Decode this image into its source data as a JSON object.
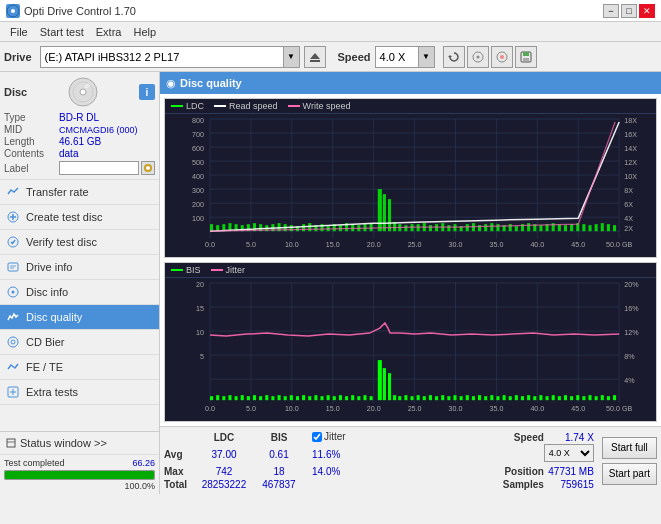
{
  "app": {
    "title": "Opti Drive Control 1.70",
    "icon": "disc-icon"
  },
  "titlebar": {
    "title": "Opti Drive Control 1.70",
    "minimize": "−",
    "maximize": "□",
    "close": "✕"
  },
  "menubar": {
    "items": [
      "File",
      "Start test",
      "Extra",
      "Help"
    ]
  },
  "drive_bar": {
    "label": "Drive",
    "drive_value": "(E:)  ATAPI iHBS312  2 PL17",
    "speed_label": "Speed",
    "speed_value": "4.0 X"
  },
  "disc_info": {
    "type_label": "Type",
    "type_value": "BD-R DL",
    "mid_label": "MID",
    "mid_value": "CMCMAGDI6 (000)",
    "length_label": "Length",
    "length_value": "46.61 GB",
    "contents_label": "Contents",
    "contents_value": "data",
    "label_label": "Label",
    "label_value": ""
  },
  "sidebar": {
    "items": [
      {
        "id": "transfer-rate",
        "label": "Transfer rate",
        "active": false
      },
      {
        "id": "create-test-disc",
        "label": "Create test disc",
        "active": false
      },
      {
        "id": "verify-test-disc",
        "label": "Verify test disc",
        "active": false
      },
      {
        "id": "drive-info",
        "label": "Drive info",
        "active": false
      },
      {
        "id": "disc-info",
        "label": "Disc info",
        "active": false
      },
      {
        "id": "disc-quality",
        "label": "Disc quality",
        "active": true
      },
      {
        "id": "cd-bier",
        "label": "CD Bier",
        "active": false
      },
      {
        "id": "fe-te",
        "label": "FE / TE",
        "active": false
      },
      {
        "id": "extra-tests",
        "label": "Extra tests",
        "active": false
      }
    ],
    "status_window": "Status window >>",
    "progress_label": "Test completed",
    "progress_percent": 100,
    "progress_text": "100.0%"
  },
  "chart_header": {
    "title": "Disc quality"
  },
  "chart1": {
    "legend": [
      {
        "label": "LDC",
        "color": "#00ff00"
      },
      {
        "label": "Read speed",
        "color": "#ffffff"
      },
      {
        "label": "Write speed",
        "color": "#ff69b4"
      }
    ],
    "y_max": 800,
    "y_right_labels": [
      "18X",
      "16X",
      "14X",
      "12X",
      "10X",
      "8X",
      "6X",
      "4X",
      "2X"
    ],
    "x_labels": [
      "0.0",
      "5.0",
      "10.0",
      "15.0",
      "20.0",
      "25.0",
      "30.0",
      "35.0",
      "40.0",
      "45.0",
      "50.0 GB"
    ]
  },
  "chart2": {
    "legend": [
      {
        "label": "BIS",
        "color": "#00ff00"
      },
      {
        "label": "Jitter",
        "color": "#ff69b4"
      }
    ],
    "y_max": 20,
    "y_right_labels": [
      "20%",
      "16%",
      "12%",
      "8%",
      "4%"
    ],
    "x_labels": [
      "0.0",
      "5.0",
      "10.0",
      "15.0",
      "20.0",
      "25.0",
      "30.0",
      "35.0",
      "40.0",
      "45.0",
      "50.0 GB"
    ]
  },
  "stats": {
    "columns": [
      "",
      "LDC",
      "BIS",
      "",
      "Jitter",
      "Speed"
    ],
    "avg_label": "Avg",
    "avg_ldc": "37.00",
    "avg_bis": "0.61",
    "avg_jitter": "11.6%",
    "max_label": "Max",
    "max_ldc": "742",
    "max_bis": "18",
    "max_jitter": "14.0%",
    "total_label": "Total",
    "total_ldc": "28253222",
    "total_bis": "467837",
    "jitter_checked": true,
    "speed_label": "Speed",
    "speed_value": "1.74 X",
    "speed_setting": "4.0 X",
    "position_label": "Position",
    "position_value": "47731 MB",
    "samples_label": "Samples",
    "samples_value": "759615",
    "start_full_label": "Start full",
    "start_part_label": "Start part"
  },
  "status_bar": {
    "text": "66.26"
  }
}
